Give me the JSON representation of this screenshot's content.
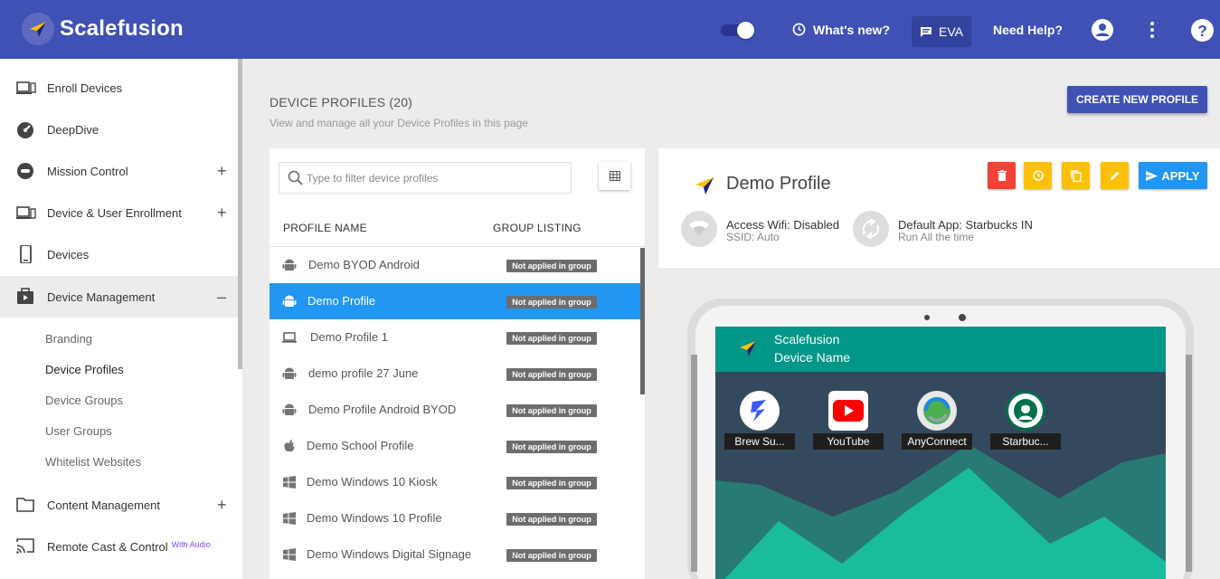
{
  "topbar": {
    "brand": "Scalefusion",
    "whats_new": "What's new?",
    "eva": "EVA",
    "need_help": "Need Help?",
    "color": "#3f51b5"
  },
  "sidebar": {
    "items": [
      {
        "label": "Enroll Devices",
        "icon": "enroll-icon"
      },
      {
        "label": "DeepDive",
        "icon": "speedometer-icon"
      },
      {
        "label": "Mission Control",
        "icon": "mission-control-icon",
        "expand": "+"
      },
      {
        "label": "Device & User Enrollment",
        "icon": "device-user-icon",
        "expand": "+"
      },
      {
        "label": "Devices",
        "icon": "phone-icon"
      },
      {
        "label": "Device Management",
        "icon": "device-management-icon",
        "expand": "–"
      }
    ],
    "subitems": [
      "Branding",
      "Device Profiles",
      "Device Groups",
      "User Groups",
      "Whitelist Websites"
    ],
    "content_management": {
      "label": "Content Management",
      "expand": "+"
    },
    "remote_cast": {
      "label": "Remote Cast & Control",
      "badge": "With Audio"
    }
  },
  "page": {
    "title": "DEVICE PROFILES (20)",
    "subtitle": "View and manage all your Device Profiles in this page",
    "create_button": "CREATE NEW PROFILE"
  },
  "list": {
    "search_placeholder": "Type to filter device profiles",
    "col_name": "PROFILE NAME",
    "col_group": "GROUP LISTING",
    "rows": [
      {
        "name": "Demo BYOD Android",
        "icon": "android-icon",
        "status": "Not applied in group"
      },
      {
        "name": "Demo Profile",
        "icon": "android-icon",
        "status": "Not applied in group",
        "selected": true
      },
      {
        "name": "Demo Profile 1",
        "icon": "laptop-icon",
        "status": "Not applied in group"
      },
      {
        "name": "demo profile 27 June",
        "icon": "android-icon",
        "status": "Not applied in group"
      },
      {
        "name": "Demo Profile Android BYOD",
        "icon": "android-icon",
        "status": "Not applied in group"
      },
      {
        "name": "Demo School Profile",
        "icon": "apple-icon",
        "status": "Not applied in group"
      },
      {
        "name": "Demo Windows 10 Kiosk",
        "icon": "windows-icon",
        "status": "Not applied in group"
      },
      {
        "name": "Demo Windows 10 Profile",
        "icon": "windows-icon",
        "status": "Not applied in group"
      },
      {
        "name": "Demo Windows Digital Signage",
        "icon": "windows-icon",
        "status": "Not applied in group"
      }
    ]
  },
  "detail": {
    "title": "Demo Profile",
    "apply": "APPLY",
    "wifi_title": "Access Wifi: Disabled",
    "wifi_sub": "SSID: Auto",
    "app_title": "Default App: Starbucks IN",
    "app_sub": "Run All the time",
    "colors": {
      "delete": "#f44336",
      "warn": "#ffc107",
      "apply": "#2196f3"
    }
  },
  "device": {
    "header1": "Scalefusion",
    "header2": "Device Name",
    "apps": [
      "Brew Su...",
      "YouTube",
      "AnyConnect",
      "Starbuc..."
    ]
  }
}
